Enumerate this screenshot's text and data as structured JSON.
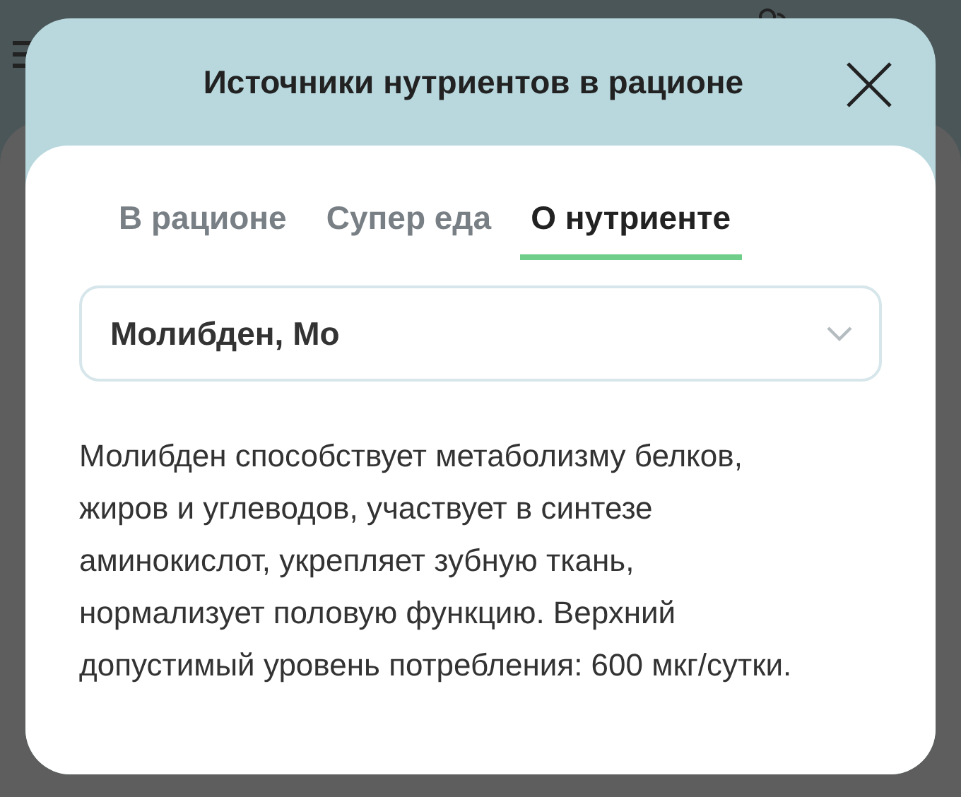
{
  "dialog": {
    "title": "Источники нутриентов в рационе"
  },
  "tabs": [
    {
      "label": "В рационе",
      "selected": false
    },
    {
      "label": "Супер еда",
      "selected": false
    },
    {
      "label": "О нутриенте",
      "selected": true
    }
  ],
  "nutrient_select": {
    "value": "Молибден, Мо"
  },
  "description": "Молибден способствует метаболизму белков, жиров и углеводов, участвует в синтезе аминокислот, укрепляет зубную ткань, нормализует половую функцию. Верхний допустимый уровень потребления: 600 мкг/сутки."
}
